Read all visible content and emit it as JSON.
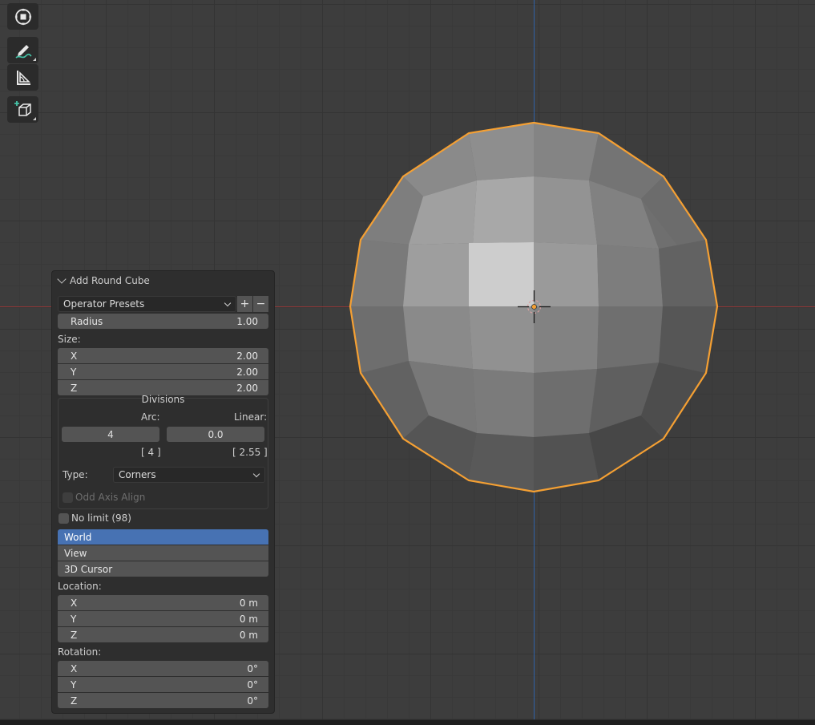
{
  "panel": {
    "title": "Add Round Cube",
    "operator_presets": "Operator Presets",
    "add_preset": "+",
    "remove_preset": "−",
    "radius": {
      "label": "Radius",
      "value": "1.00"
    },
    "size": {
      "label": "Size:",
      "x": {
        "label": "X",
        "value": "2.00"
      },
      "y": {
        "label": "Y",
        "value": "2.00"
      },
      "z": {
        "label": "Z",
        "value": "2.00"
      }
    },
    "divisions": {
      "title": "Divisions",
      "arc_label": "Arc:",
      "linear_label": "Linear:",
      "arc_value": "4",
      "linear_value": "0.0",
      "arc_info": "[ 4 ]",
      "linear_info": "[ 2.55 ]",
      "type_label": "Type:",
      "type_value": "Corners",
      "odd_axis_align": "Odd Axis Align"
    },
    "no_limit": "No limit (98)",
    "align": {
      "options": [
        "World",
        "View",
        "3D Cursor"
      ],
      "selected": "World"
    },
    "location": {
      "label": "Location:",
      "x": {
        "label": "X",
        "value": "0 m"
      },
      "y": {
        "label": "Y",
        "value": "0 m"
      },
      "z": {
        "label": "Z",
        "value": "0 m"
      }
    },
    "rotation": {
      "label": "Rotation:",
      "x": {
        "label": "X",
        "value": "0°"
      },
      "y": {
        "label": "Y",
        "value": "0°"
      },
      "z": {
        "label": "Z",
        "value": "0°"
      }
    }
  },
  "toolbar": {
    "tools": [
      "transform-icon",
      "annotate-icon",
      "measure-icon",
      "add-cube-icon"
    ]
  },
  "colors": {
    "selection_outline": "#f5a033",
    "active_option": "#4772b3",
    "x_axis": "#8d3737",
    "y_axis": "#2f62a6"
  }
}
